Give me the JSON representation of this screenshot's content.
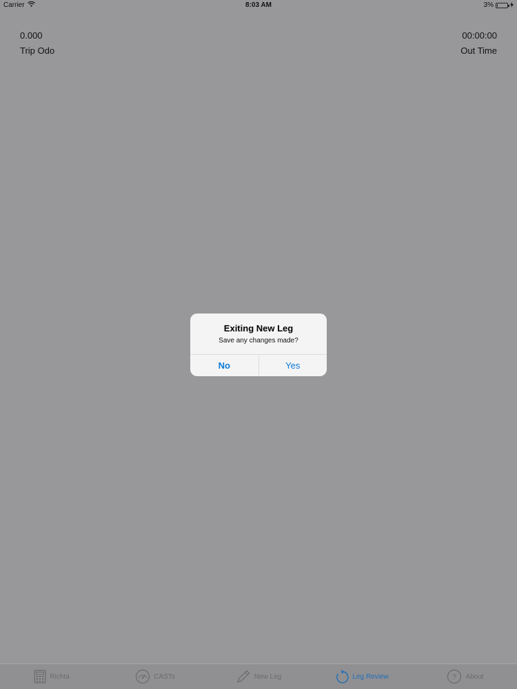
{
  "status_bar": {
    "carrier": "Carrier",
    "time": "8:03 AM",
    "battery": "3%"
  },
  "readouts": {
    "trip_odo_value": "0.000",
    "trip_odo_label": "Trip Odo",
    "out_time_value": "00:00:00",
    "out_time_label": "Out Time"
  },
  "alert": {
    "title": "Exiting New Leg",
    "message": "Save any changes made?",
    "no_label": "No",
    "yes_label": "Yes"
  },
  "tab_bar": {
    "items": [
      {
        "label": "Richta",
        "icon": "calculator-icon",
        "active": false
      },
      {
        "label": "CASTs",
        "icon": "speedometer-icon",
        "active": false
      },
      {
        "label": "New Leg",
        "icon": "pencil-icon",
        "active": false
      },
      {
        "label": "Leg Review",
        "icon": "refresh-icon",
        "active": true
      },
      {
        "label": "About",
        "icon": "question-circle-icon",
        "active": false
      }
    ]
  },
  "colors": {
    "background": "#98979a",
    "accent": "#0a7ad8",
    "active_tab": "#1f6fb8"
  }
}
